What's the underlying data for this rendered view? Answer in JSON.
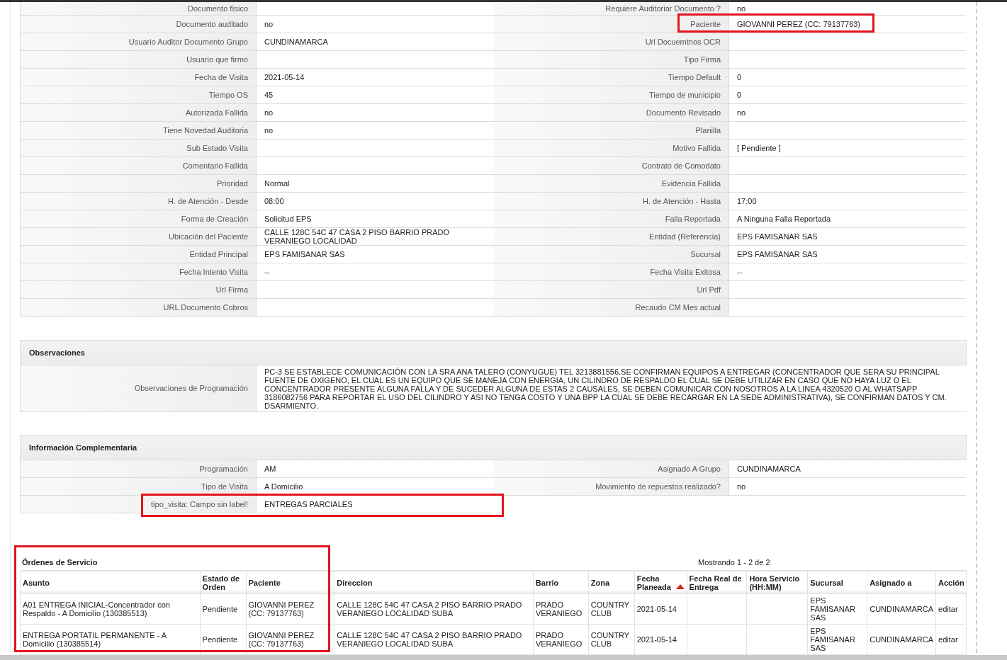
{
  "details": {
    "rows": [
      {
        "left": {
          "label": "Documento físico",
          "highlighted": false
        },
        "right": {
          "label": "Requiere Auditoriar Documento ?",
          "value": "no",
          "highlighted": false
        }
      },
      {
        "left": {
          "label": "Documento auditado",
          "value": "no",
          "highlighted": false
        },
        "right": {
          "label": "Paciente",
          "value": "GIOVANNI PEREZ (CC: 79137763)",
          "highlighted": true
        }
      },
      {
        "left": {
          "label": "Usuario Auditor Documento Grupo",
          "value": "CUNDINAMARCA",
          "highlighted": false
        },
        "right": {
          "label": "Url Docuemtnos OCR",
          "highlighted": false
        }
      },
      {
        "left": {
          "label": "Usuario que firmo",
          "highlighted": false
        },
        "right": {
          "label": "Tipo Firma",
          "highlighted": false
        }
      },
      {
        "left": {
          "label": "Fecha de Visita",
          "value": "2021-05-14",
          "highlighted": false
        },
        "right": {
          "label": "Tiempo Default",
          "value": "0",
          "highlighted": false
        }
      },
      {
        "left": {
          "label": "Tiempo OS",
          "value": "45",
          "highlighted": false
        },
        "right": {
          "label": "Tiempo de municipio",
          "value": "0",
          "highlighted": false
        }
      },
      {
        "left": {
          "label": "Autorizada Fallida",
          "value": "no",
          "highlighted": false
        },
        "right": {
          "label": "Documento Revisado",
          "value": "no",
          "highlighted": false
        }
      },
      {
        "left": {
          "label": "Tiene Novedad Auditoria",
          "value": "no",
          "highlighted": false
        },
        "right": {
          "label": "Planilla",
          "highlighted": false
        }
      },
      {
        "left": {
          "label": "Sub Estado Visita",
          "highlighted": false
        },
        "right": {
          "label": "Motivo Fallida",
          "value": "[ Pendiente ]",
          "highlighted": false
        }
      },
      {
        "left": {
          "label": "Comentario Fallida",
          "highlighted": false
        },
        "right": {
          "label": "Contrato de Comodato",
          "highlighted": false
        }
      },
      {
        "left": {
          "label": "Prioridad",
          "value": "Normal",
          "highlighted": false
        },
        "right": {
          "label": "Evidencia Fallida",
          "highlighted": false
        }
      },
      {
        "left": {
          "label": "H. de Atención - Desde",
          "value": "08:00",
          "highlighted": false
        },
        "right": {
          "label": "H. de Atención - Hasta",
          "value": "17:00",
          "highlighted": false
        }
      },
      {
        "left": {
          "label": "Forma de Creación",
          "value": "Solicitud EPS",
          "highlighted": false
        },
        "right": {
          "label": "Falla Reportada",
          "value": "A Ninguna Falla Reportada",
          "highlighted": false
        }
      },
      {
        "left": {
          "label": "Ubicación del Paciente",
          "value": "CALLE 128C 54C 47 CASA 2 PISO BARRIO PRADO VERANIEGO LOCALIDAD",
          "highlighted": false
        },
        "right": {
          "label": "Entidad (Referencia)",
          "value": "EPS FAMISANAR SAS",
          "highlighted": false
        }
      },
      {
        "left": {
          "label": "Entidad Principal",
          "value": "EPS FAMISANAR SAS",
          "highlighted": false
        },
        "right": {
          "label": "Sucursal",
          "value": "EPS FAMISANAR SAS",
          "highlighted": false
        }
      },
      {
        "left": {
          "label": "Fecha Intento Visita",
          "value": "--",
          "highlighted": false
        },
        "right": {
          "label": "Fecha Visita Exitosa",
          "value": "--",
          "highlighted": false
        }
      },
      {
        "left": {
          "label": "Url Firma",
          "highlighted": false
        },
        "right": {
          "label": "Url Pdf",
          "highlighted": false
        }
      },
      {
        "left": {
          "label": "URL Documento Cobros",
          "highlighted": false
        },
        "right": {
          "label": "Recaudo CM Mes actual",
          "highlighted": false
        }
      }
    ]
  },
  "observaciones": {
    "title": "Observaciones",
    "label": "Observaciones de Programación",
    "value": "PC-3 SE ESTABLECE COMUNICACIÓN CON LA SRA ANA TALERO (CONYUGUE) TEL 3213881556.SE CONFIRMAN EQUIPOS A ENTREGAR (CONCENTRADOR QUE SERA SU PRINCIPAL FUENTE DE OXIGENO, EL CUAL ES UN EQUIPO QUE SE MANEJA CON ENERGIA, UN CILINDRO DE RESPALDO EL CUAL SE DEBE UTILIZAR EN CASO QUE NO HAYA LUZ O EL CONCENTRADOR PRESENTE ALGUNA FALLA Y DE SUCEDER ALGUNA DE ESTAS 2 CAUSALES, SE DEBEN COMUNICAR CON NOSOTROS A LA LINEA 4320520 O AL WHATSAPP 3186082756 PARA REPORTAR EL USO DEL CILINDRO Y ASI NO TENGA COSTO Y UNA BPP LA CUAL SE DEBE RECARGAR EN LA SEDE ADMINISTRATIVA), SE CONFIRMAN DATOS Y CM. DSARMIENTO."
  },
  "complementaria": {
    "title": "Información Complementaria",
    "rows": [
      {
        "left": {
          "label": "Programación",
          "value": "AM",
          "highlighted": false
        },
        "right": {
          "label": "Asignado A Grupo",
          "value": "CUNDINAMARCA",
          "highlighted": false
        }
      },
      {
        "left": {
          "label": "Tipo de Visita",
          "value": "A Domicilio",
          "highlighted": false
        },
        "right": {
          "label": "Movimiento de repuestos realizado?",
          "value": "no",
          "highlighted": false
        }
      },
      {
        "left": {
          "label": "tipo_visita: Campo sin label!",
          "value": "ENTREGAS PARCIALES",
          "highlighted": true
        }
      }
    ]
  },
  "ordenes": {
    "title": "Órdenes de Servicio",
    "highlighted": true,
    "paging": "Mostrando 1 - 2 de 2",
    "columns": [
      {
        "label": "Asunto",
        "sorted": false
      },
      {
        "label": "Estado de Orden",
        "sorted": false
      },
      {
        "label": "Paciente",
        "sorted": false
      },
      {
        "label": "Direccion",
        "sorted": false
      },
      {
        "label": "Barrio",
        "sorted": false
      },
      {
        "label": "Zona",
        "sorted": false
      },
      {
        "label": "Fecha Planeada",
        "sorted": true
      },
      {
        "label": "Fecha Real de Entrega",
        "sorted": false
      },
      {
        "label": "Hora Servicio (HH:MM)",
        "sorted": false
      },
      {
        "label": "Sucursal",
        "sorted": false
      },
      {
        "label": "Asignado a",
        "sorted": false
      },
      {
        "label": "Acción",
        "sorted": false
      }
    ],
    "rows": [
      {
        "asunto": "A01 ENTREGA INICIAL-Concentrador con Respaldo - A Domicilio (130385513)",
        "estado": "Pendiente",
        "paciente": "GIOVANNI PEREZ (CC: 79137763)",
        "direccion": "CALLE 128C 54C 47 CASA 2 PISO BARRIO PRADO VERANIEGO LOCALIDAD SUBA",
        "barrio": "PRADO VERANIEGO",
        "zona": "COUNTRY CLUB",
        "fecha_planeada": "2021-05-14",
        "sucursal": "EPS FAMISANAR SAS",
        "asignado": "CUNDINAMARCA",
        "accion": "editar"
      },
      {
        "asunto": "ENTREGA PORTATIL PERMANENTE - A Domicilio (130385514)",
        "estado": "Pendiente",
        "paciente": "GIOVANNI PEREZ (CC: 79137763)",
        "direccion": "CALLE 128C 54C 47 CASA 2 PISO BARRIO PRADO VERANIEGO LOCALIDAD SUBA",
        "barrio": "PRADO VERANIEGO",
        "zona": "COUNTRY CLUB",
        "fecha_planeada": "2021-05-14",
        "sucursal": "EPS FAMISANAR SAS",
        "asignado": "CUNDINAMARCA",
        "accion": "editar"
      }
    ]
  }
}
